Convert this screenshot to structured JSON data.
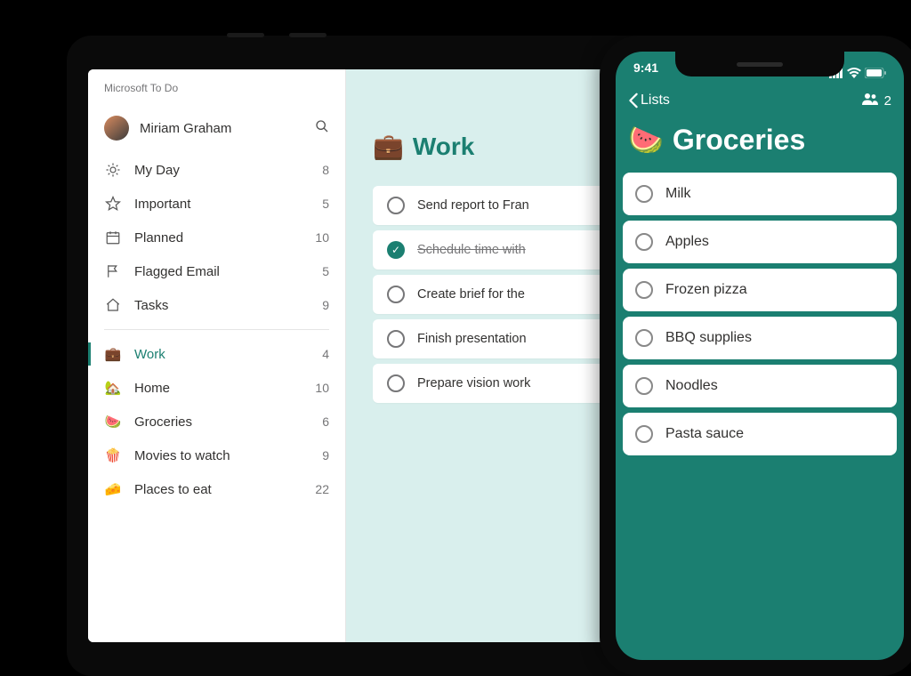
{
  "tablet": {
    "app_title": "Microsoft To Do",
    "user": {
      "name": "Miriam Graham"
    },
    "nav_smart": [
      {
        "icon": "sun",
        "label": "My Day",
        "count": 8
      },
      {
        "icon": "star",
        "label": "Important",
        "count": 5
      },
      {
        "icon": "cal",
        "label": "Planned",
        "count": 10
      },
      {
        "icon": "flag",
        "label": "Flagged Email",
        "count": 5
      },
      {
        "icon": "home",
        "label": "Tasks",
        "count": 9
      }
    ],
    "nav_lists": [
      {
        "emoji": "💼",
        "label": "Work",
        "count": 4,
        "selected": true
      },
      {
        "emoji": "🏡",
        "label": "Home",
        "count": 10
      },
      {
        "emoji": "🍉",
        "label": "Groceries",
        "count": 6
      },
      {
        "emoji": "🍿",
        "label": "Movies to watch",
        "count": 9
      },
      {
        "emoji": "🧀",
        "label": "Places to eat",
        "count": 22
      }
    ],
    "main": {
      "title_emoji": "💼",
      "title": "Work",
      "tasks": [
        {
          "label": "Send report to Fran",
          "done": false
        },
        {
          "label": "Schedule time with",
          "done": true
        },
        {
          "label": "Create brief for the",
          "done": false
        },
        {
          "label": "Finish presentation",
          "done": false
        },
        {
          "label": "Prepare vision work",
          "done": false
        }
      ]
    }
  },
  "phone": {
    "time": "9:41",
    "back_label": "Lists",
    "share_count": 2,
    "title_emoji": "🍉",
    "title": "Groceries",
    "items": [
      "Milk",
      "Apples",
      "Frozen pizza",
      "BBQ supplies",
      "Noodles",
      "Pasta sauce"
    ]
  }
}
